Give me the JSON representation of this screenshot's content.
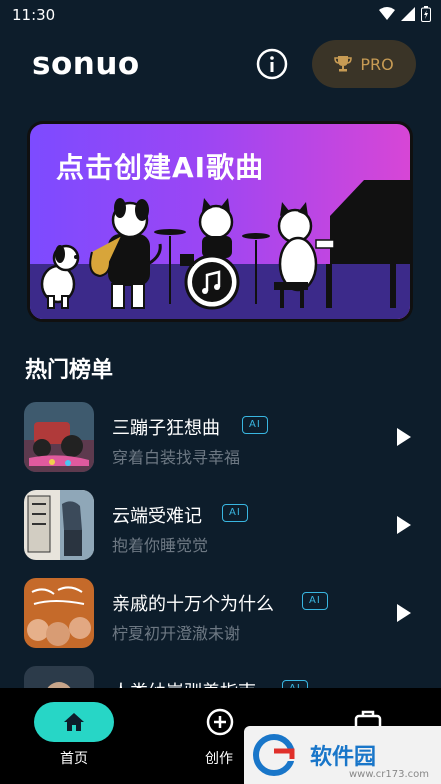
{
  "status": {
    "time": "11:30"
  },
  "header": {
    "title": "sonuo",
    "pro_label": "PRO"
  },
  "banner": {
    "title": "点击创建AI歌曲"
  },
  "section": {
    "title": "热门榜单"
  },
  "songs": [
    {
      "name": "三蹦子狂想曲",
      "badge": "AI",
      "subtitle": "穿着白装找寻幸福"
    },
    {
      "name": "云端受难记",
      "badge": "AI",
      "subtitle": "抱着你睡觉觉"
    },
    {
      "name": "亲戚的十万个为什么",
      "badge": "AI",
      "subtitle": "柠夏初开澄澈未谢"
    },
    {
      "name": "人类幼崽驯养指南",
      "badge": "AI",
      "subtitle": ""
    }
  ],
  "nav": {
    "home": "首页",
    "create": "创作"
  },
  "watermark": {
    "brand": "软件园",
    "url": "www.cr173.com"
  },
  "colors": {
    "background": "#0d1d2b",
    "accent": "#27d6c6",
    "badge": "#39b6e0",
    "pro": "#c79b54"
  }
}
